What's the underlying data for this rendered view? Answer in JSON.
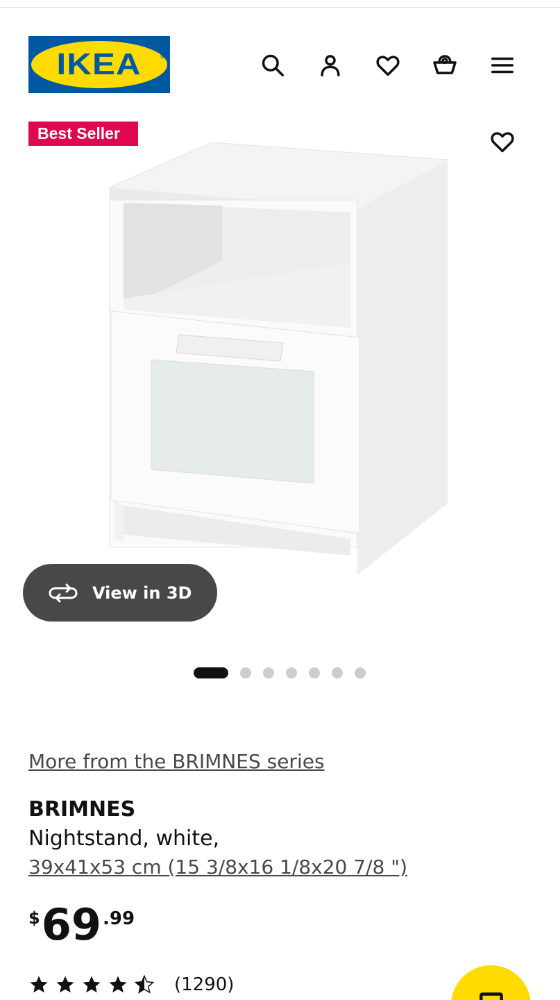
{
  "header": {
    "logo_text": "IKEA",
    "logo_mark": "®",
    "icons": [
      "search-icon",
      "account-icon",
      "heart-icon",
      "basket-icon",
      "menu-icon"
    ]
  },
  "media": {
    "badge": "Best Seller",
    "view_3d_label": "View in 3D",
    "carousel_dots": 7,
    "active_dot": 1
  },
  "product": {
    "series_link": "More from the BRIMNES series",
    "name": "BRIMNES",
    "description": "Nightstand, white,",
    "size": "39x41x53 cm (15 3/8x16 1/8x20 7/8 \")",
    "price": {
      "currency": "$",
      "integer": "69",
      "decimal": ".99"
    },
    "rating": {
      "stars": 4.5,
      "max": 5,
      "count": "(1290)"
    }
  },
  "colors": {
    "ikea_blue": "#0058a3",
    "ikea_yellow": "#ffdb00",
    "badge_red": "#e00751",
    "button_dark": "#484848"
  }
}
